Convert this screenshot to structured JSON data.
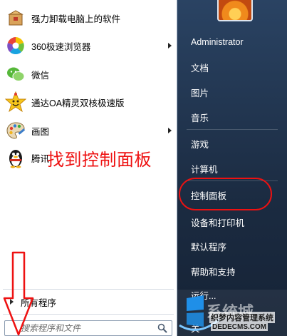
{
  "programs": [
    {
      "label": "强力卸载电脑上的软件",
      "icon": "uninstall-box-icon"
    },
    {
      "label": "360极速浏览器",
      "icon": "360-browser-icon",
      "submenu": true
    },
    {
      "label": "微信",
      "icon": "wechat-icon"
    },
    {
      "label": "通达OA精灵双核极速版",
      "icon": "star-face-icon"
    },
    {
      "label": "画图",
      "icon": "paint-palette-icon",
      "submenu": true
    },
    {
      "label": "腾讯",
      "icon": "qq-penguin-icon"
    }
  ],
  "all_programs_label": "所有程序",
  "search": {
    "placeholder": "搜索程序和文件"
  },
  "right_items": [
    {
      "label": "Administrator"
    },
    {
      "label": "文档"
    },
    {
      "label": "图片"
    },
    {
      "label": "音乐"
    },
    {
      "label": "游戏"
    },
    {
      "label": "计算机"
    },
    {
      "label": "控制面板"
    },
    {
      "label": "设备和打印机"
    },
    {
      "label": "默认程序"
    },
    {
      "label": "帮助和支持"
    },
    {
      "label": "运行..."
    },
    {
      "label": "关"
    }
  ],
  "annotation": {
    "text": "找到控制面板",
    "color": "#ee1111"
  },
  "watermark": {
    "text_large": "系统城",
    "text_small": "织梦内容管理系统",
    "url": "DEDECMS.COM"
  }
}
